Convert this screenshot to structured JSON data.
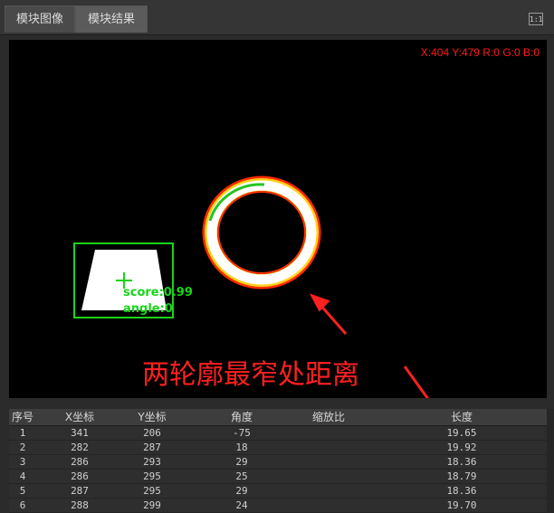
{
  "tabs": [
    {
      "label": "模块图像"
    },
    {
      "label": "模块结果"
    }
  ],
  "fit_button_label": "1:1",
  "viewer": {
    "pixel_readout": "X:404 Y:479  R:0 G:0 B:0",
    "match": {
      "score_label": "score:0.99",
      "angle_label": "angle:0"
    },
    "annotation": "两轮廓最窄处距离",
    "colors": {
      "match_box": "#19d419",
      "annotation": "#ff2020",
      "contour_edge": "#ff2a00",
      "contour_fill": "#ffffff",
      "ring_highlight": "#ffd21a"
    }
  },
  "table": {
    "headers": [
      "序号",
      "X坐标",
      "Y坐标",
      "角度",
      "缩放比",
      "长度"
    ],
    "rows": [
      [
        "1",
        "341",
        "206",
        "-75",
        "",
        "19.65"
      ],
      [
        "2",
        "282",
        "287",
        "18",
        "",
        "19.92"
      ],
      [
        "3",
        "286",
        "293",
        "29",
        "",
        "18.36"
      ],
      [
        "4",
        "286",
        "295",
        "25",
        "",
        "18.79"
      ],
      [
        "5",
        "287",
        "295",
        "29",
        "",
        "18.36"
      ],
      [
        "6",
        "288",
        "299",
        "24",
        "",
        "19.70"
      ]
    ]
  }
}
